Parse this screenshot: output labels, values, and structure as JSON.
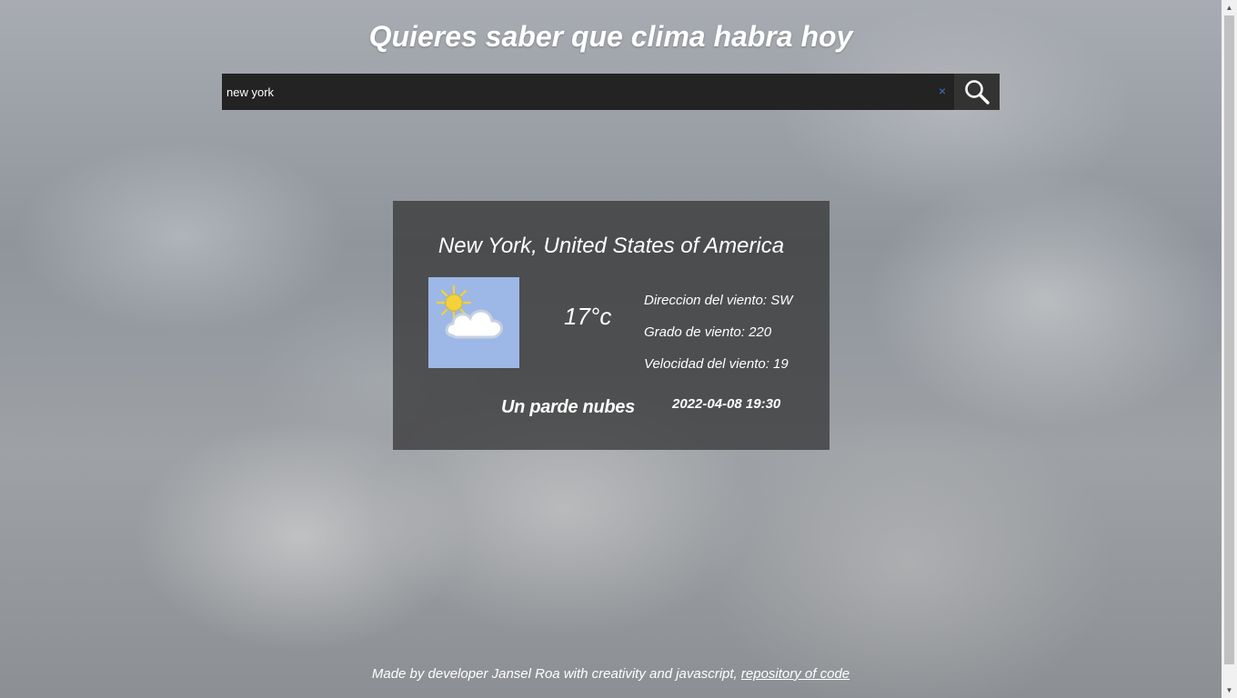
{
  "header": {
    "title": "Quieres saber que clima habra hoy"
  },
  "search": {
    "value": "new york",
    "clear_glyph": "×",
    "button_icon": "search-icon"
  },
  "weather": {
    "city": "New York, United States of America",
    "icon": "partly-cloudy-icon",
    "temperature": "17°c",
    "wind_direction": "Direccion del viento: SW",
    "wind_degree": "Grado de viento: 220",
    "wind_speed": "Velocidad del viento: 19",
    "description": "Un parde nubes",
    "datetime": "2022-04-08 19:30"
  },
  "footer": {
    "text": "Made by developer Jansel Roa with creativity and javascript,",
    "link_label": "repository of code"
  },
  "colors": {
    "card_bg": "#303030",
    "search_bg": "#232323",
    "search_button_bg": "#333333",
    "clear_icon": "#3a74c8",
    "icon_bg": "#9db8e6"
  }
}
